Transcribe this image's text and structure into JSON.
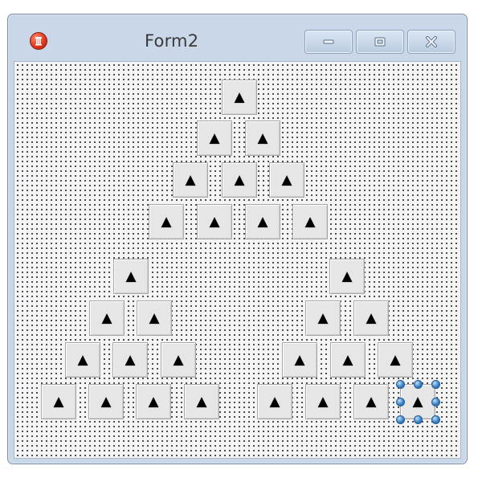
{
  "window": {
    "title": "Form2",
    "app_icon": "app-icon",
    "caption_buttons": [
      "minimize-icon",
      "maximize-icon",
      "close-icon"
    ]
  },
  "designer": {
    "button_glyph": "▲",
    "button_count": 30,
    "selected_button": "tri-btn-30"
  }
}
